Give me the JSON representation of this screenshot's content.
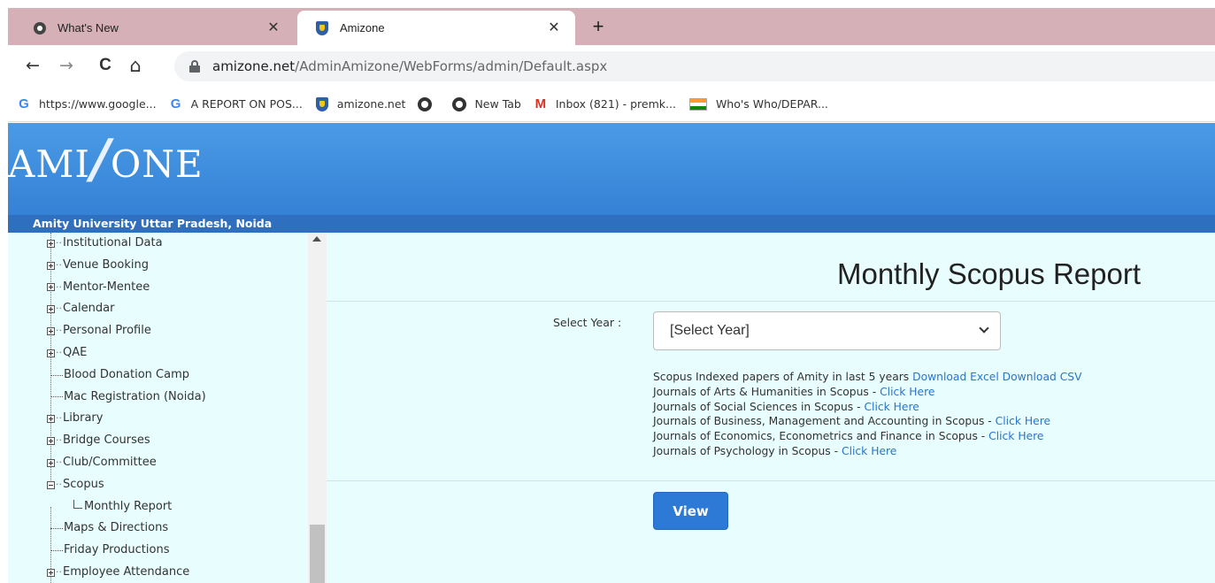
{
  "browser": {
    "tabs": [
      {
        "title": "What's New",
        "close": "✕",
        "icon": "chrome-icon"
      },
      {
        "title": "Amizone",
        "close": "✕",
        "icon": "amizone-shield-icon"
      }
    ],
    "new_tab": "+",
    "nav": {
      "back": "←",
      "forward": "→",
      "reload": "C",
      "home": "⌂"
    },
    "url_host": "amizone.net",
    "url_path": "/AdminAmizone/WebForms/admin/Default.aspx",
    "bookmarks": [
      {
        "label": "https://www.google...",
        "icon": "google-icon"
      },
      {
        "label": "A REPORT ON POS...",
        "icon": "google-icon"
      },
      {
        "label": "amizone.net",
        "icon": "amizone-shield-icon"
      },
      {
        "label": "",
        "icon": "globe-icon"
      },
      {
        "label": "New Tab",
        "icon": "globe-icon"
      },
      {
        "label": "Inbox (821) - premk...",
        "icon": "gmail-icon"
      },
      {
        "label": "Who's Who/DEPAR...",
        "icon": "india-flag-icon"
      }
    ]
  },
  "header": {
    "logo_left": "AMI",
    "logo_slash": "/",
    "logo_right": "ONE",
    "org_name": "Amity University Uttar Pradesh, Noida"
  },
  "sidebar": {
    "items": [
      {
        "label": "Institutional Data",
        "type": "plus"
      },
      {
        "label": "Venue Booking",
        "type": "plus"
      },
      {
        "label": "Mentor-Mentee",
        "type": "plus"
      },
      {
        "label": "Calendar",
        "type": "plus"
      },
      {
        "label": "Personal Profile",
        "type": "plus"
      },
      {
        "label": "QAE",
        "type": "plus"
      },
      {
        "label": "Blood Donation Camp",
        "type": "leaf"
      },
      {
        "label": "Mac Registration (Noida)",
        "type": "leaf"
      },
      {
        "label": "Library",
        "type": "plus"
      },
      {
        "label": "Bridge Courses",
        "type": "plus"
      },
      {
        "label": "Club/Committee",
        "type": "plus"
      },
      {
        "label": "Scopus",
        "type": "minus"
      },
      {
        "label": "Monthly Report",
        "type": "child"
      },
      {
        "label": "Maps & Directions",
        "type": "leaf"
      },
      {
        "label": "Friday Productions",
        "type": "leaf"
      },
      {
        "label": "Employee Attendance",
        "type": "plus"
      }
    ]
  },
  "main": {
    "title": "Monthly Scopus Report",
    "year_label": "Select Year :",
    "year_selected": "[Select Year]",
    "links": [
      {
        "text": "Scopus Indexed papers of Amity in last 5 years",
        "link1": "Download Excel",
        "link2": "Download CSV"
      },
      {
        "text": "Journals of Arts & Humanities in Scopus -",
        "link1": "Click Here"
      },
      {
        "text": "Journals of Social Sciences in Scopus -",
        "link1": "Click Here"
      },
      {
        "text": "Journals of Business, Management and Accounting in Scopus -",
        "link1": "Click Here"
      },
      {
        "text": "Journals of Economics, Econometrics and Finance in Scopus -",
        "link1": "Click Here"
      },
      {
        "text": "Journals of Psychology in Scopus -",
        "link1": "Click Here"
      }
    ],
    "view_button": "View"
  }
}
